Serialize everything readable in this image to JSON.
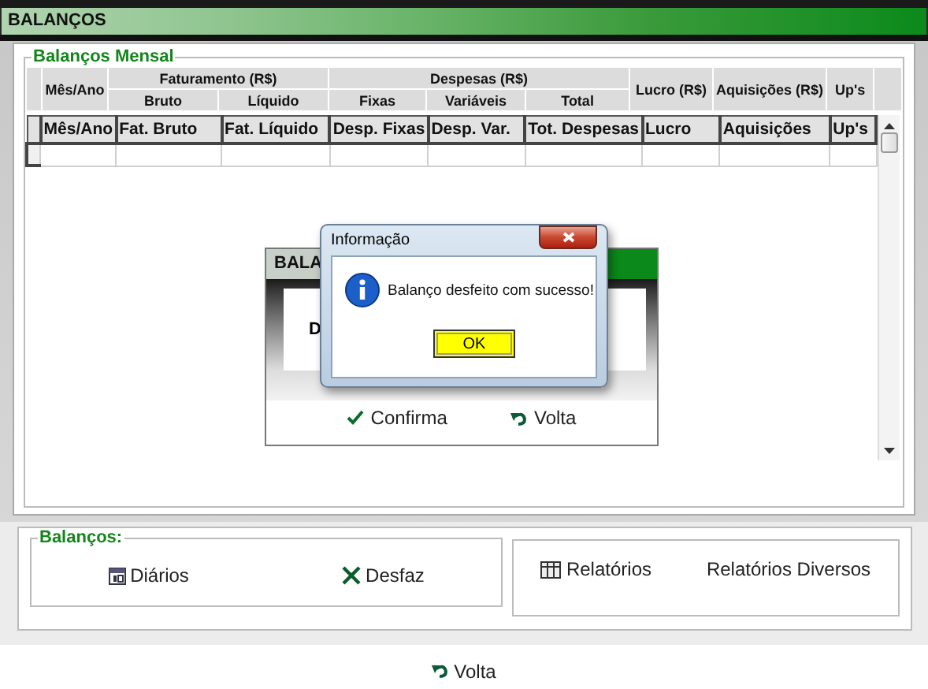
{
  "window": {
    "title": "BALANÇOS"
  },
  "monthly": {
    "title": "Balanços Mensal",
    "header_groups": [
      {
        "label": "Mês/Ano"
      },
      {
        "label": "Faturamento (R$)",
        "children": [
          "Bruto",
          "Líquido"
        ]
      },
      {
        "label": "Despesas (R$)",
        "children": [
          "Fixas",
          "Variáveis",
          "Total"
        ]
      },
      {
        "label": "Lucro (R$)"
      },
      {
        "label": "Aquisições (R$)"
      },
      {
        "label": "Up's"
      }
    ],
    "columns": [
      "Mês/Ano",
      "Fat. Bruto",
      "Fat. Líquido",
      "Desp. Fixas",
      "Desp. Var.",
      "Tot. Despesas",
      "Lucro",
      "Aquisições",
      "Up's"
    ]
  },
  "balances": {
    "title": "Balanços:",
    "buttons": [
      {
        "label": "Diários",
        "kind": "calendar"
      },
      {
        "label": "Desfaz",
        "kind": "cross"
      }
    ]
  },
  "reports": {
    "buttons": [
      {
        "label": "Relatórios",
        "kind": "table"
      },
      {
        "label": "Relatórios Diversos"
      }
    ]
  },
  "back_button": {
    "label": "Volta",
    "kind": "undo"
  },
  "sub_dialog": {
    "title": "BALA",
    "field_label": "D",
    "buttons": [
      {
        "label": "Confirma",
        "kind": "check"
      },
      {
        "label": "Volta",
        "kind": "undo"
      }
    ]
  },
  "message_box": {
    "title": "Informação",
    "message": "Balanço desfeito com sucesso!",
    "button": "OK"
  }
}
